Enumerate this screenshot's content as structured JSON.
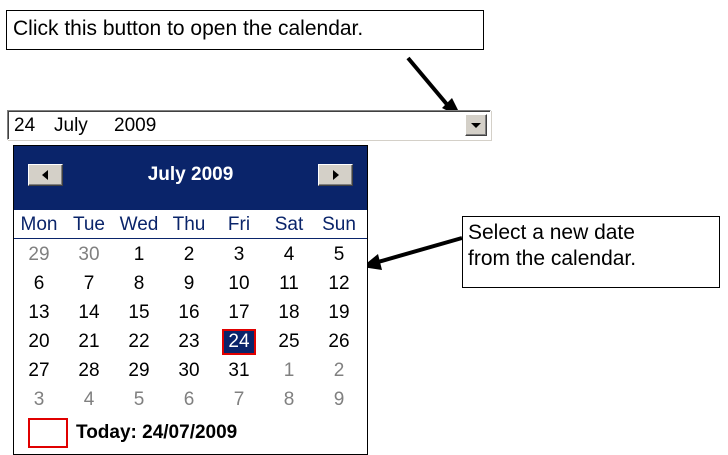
{
  "callouts": {
    "open_button": "Click this button to open the calendar.",
    "select_date_line1": "Select a new date",
    "select_date_line2": "from the calendar."
  },
  "date_combo": {
    "day": "24",
    "month": "July",
    "year": "2009",
    "button_icon": "chevron-down-icon"
  },
  "calendar": {
    "title": "July 2009",
    "prev_icon": "triangle-left-icon",
    "next_icon": "triangle-right-icon",
    "weekdays": [
      "Mon",
      "Tue",
      "Wed",
      "Thu",
      "Fri",
      "Sat",
      "Sun"
    ],
    "weeks": [
      [
        {
          "d": "29",
          "o": true
        },
        {
          "d": "30",
          "o": true
        },
        {
          "d": "1"
        },
        {
          "d": "2"
        },
        {
          "d": "3"
        },
        {
          "d": "4"
        },
        {
          "d": "5"
        }
      ],
      [
        {
          "d": "6"
        },
        {
          "d": "7"
        },
        {
          "d": "8"
        },
        {
          "d": "9"
        },
        {
          "d": "10"
        },
        {
          "d": "11"
        },
        {
          "d": "12"
        }
      ],
      [
        {
          "d": "13"
        },
        {
          "d": "14"
        },
        {
          "d": "15"
        },
        {
          "d": "16"
        },
        {
          "d": "17"
        },
        {
          "d": "18"
        },
        {
          "d": "19"
        }
      ],
      [
        {
          "d": "20"
        },
        {
          "d": "21"
        },
        {
          "d": "22"
        },
        {
          "d": "23"
        },
        {
          "d": "24",
          "sel": true
        },
        {
          "d": "25"
        },
        {
          "d": "26"
        }
      ],
      [
        {
          "d": "27"
        },
        {
          "d": "28"
        },
        {
          "d": "29"
        },
        {
          "d": "30"
        },
        {
          "d": "31"
        },
        {
          "d": "1",
          "o": true
        },
        {
          "d": "2",
          "o": true
        }
      ],
      [
        {
          "d": "3",
          "o": true
        },
        {
          "d": "4",
          "o": true
        },
        {
          "d": "5",
          "o": true
        },
        {
          "d": "6",
          "o": true
        },
        {
          "d": "7",
          "o": true
        },
        {
          "d": "8",
          "o": true
        },
        {
          "d": "9",
          "o": true
        }
      ]
    ],
    "today_label": "Today: 24/07/2009"
  },
  "colors": {
    "header_bg": "#0a246a",
    "selected_outline": "#e00000",
    "other_month_text": "#808080"
  }
}
